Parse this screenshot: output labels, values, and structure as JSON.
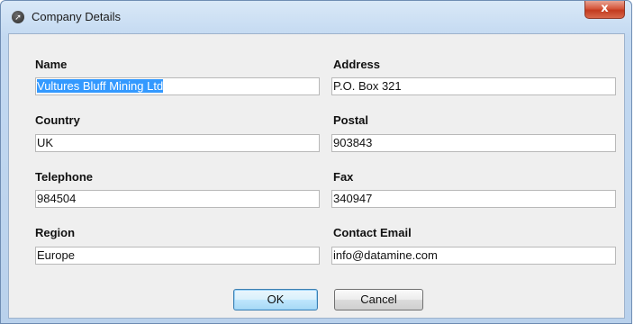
{
  "window": {
    "title": "Company Details",
    "close_label": "x"
  },
  "fields": {
    "name": {
      "label": "Name",
      "value": "Vultures Bluff Mining Ltd"
    },
    "address": {
      "label": "Address",
      "value": "P.O. Box 321"
    },
    "country": {
      "label": "Country",
      "value": "UK"
    },
    "postal": {
      "label": "Postal",
      "value": "903843"
    },
    "telephone": {
      "label": "Telephone",
      "value": "984504"
    },
    "fax": {
      "label": "Fax",
      "value": "340947"
    },
    "region": {
      "label": "Region",
      "value": "Europe"
    },
    "contact_email": {
      "label": "Contact Email",
      "value": "info@datamine.com"
    }
  },
  "buttons": {
    "ok": "OK",
    "cancel": "Cancel"
  },
  "colors": {
    "selection": "#3399ff",
    "close_button": "#c23a1f",
    "dialog_background": "#efefef"
  }
}
